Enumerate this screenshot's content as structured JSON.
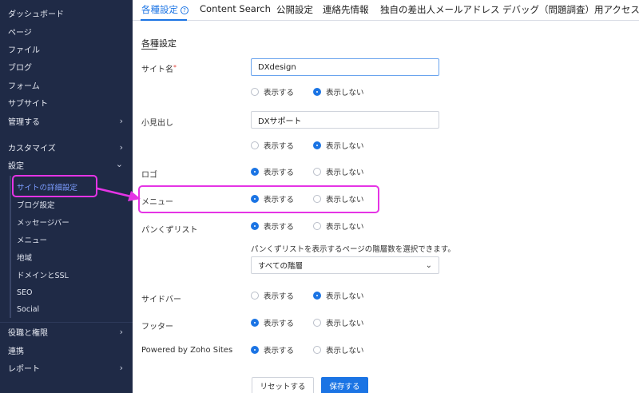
{
  "sidebar": {
    "items": [
      {
        "label": "ダッシュボード"
      },
      {
        "label": "ページ"
      },
      {
        "label": "ファイル"
      },
      {
        "label": "ブログ"
      },
      {
        "label": "フォーム"
      },
      {
        "label": "サブサイト"
      },
      {
        "label": "管理する"
      },
      {
        "label": "カスタマイズ"
      },
      {
        "label": "設定"
      },
      {
        "label": "サイトの詳細設定"
      },
      {
        "label": "ブログ設定"
      },
      {
        "label": "メッセージバー"
      },
      {
        "label": "メニュー"
      },
      {
        "label": "地域"
      },
      {
        "label": "ドメインとSSL"
      },
      {
        "label": "SEO"
      },
      {
        "label": "Social"
      },
      {
        "label": "役職と権限"
      },
      {
        "label": "連携"
      },
      {
        "label": "レポート"
      }
    ]
  },
  "tabs": [
    {
      "label": "各種設定"
    },
    {
      "label": "Content Search"
    },
    {
      "label": "公開設定"
    },
    {
      "label": "連絡先情報"
    },
    {
      "label": "独自の差出人メールアドレス"
    },
    {
      "label": "デバッグ（問題調査）用アクセス"
    }
  ],
  "section_title": "各種設定",
  "options": {
    "show": "表示する",
    "hide": "表示しない"
  },
  "fields": {
    "site_name": {
      "label": "サイト名",
      "required_mark": "*",
      "value": "DXdesign"
    },
    "subtitle": {
      "label": "小見出し",
      "value": "DXサポート"
    },
    "logo": {
      "label": "ロゴ"
    },
    "menu": {
      "label": "メニュー"
    },
    "breadcrumb": {
      "label": "パンくずリスト",
      "helper": "パンくずリストを表示するページの階層数を選択できます。",
      "select_value": "すべての階層"
    },
    "sidebar": {
      "label": "サイドバー"
    },
    "footer": {
      "label": "フッター"
    },
    "powered_by": {
      "label": "Powered by Zoho Sites"
    }
  },
  "buttons": {
    "reset": "リセットする",
    "save": "保存する"
  },
  "colors": {
    "accent": "#1b74e4",
    "sidebar_bg": "#1f2a46",
    "annotation": "#e534e5"
  }
}
